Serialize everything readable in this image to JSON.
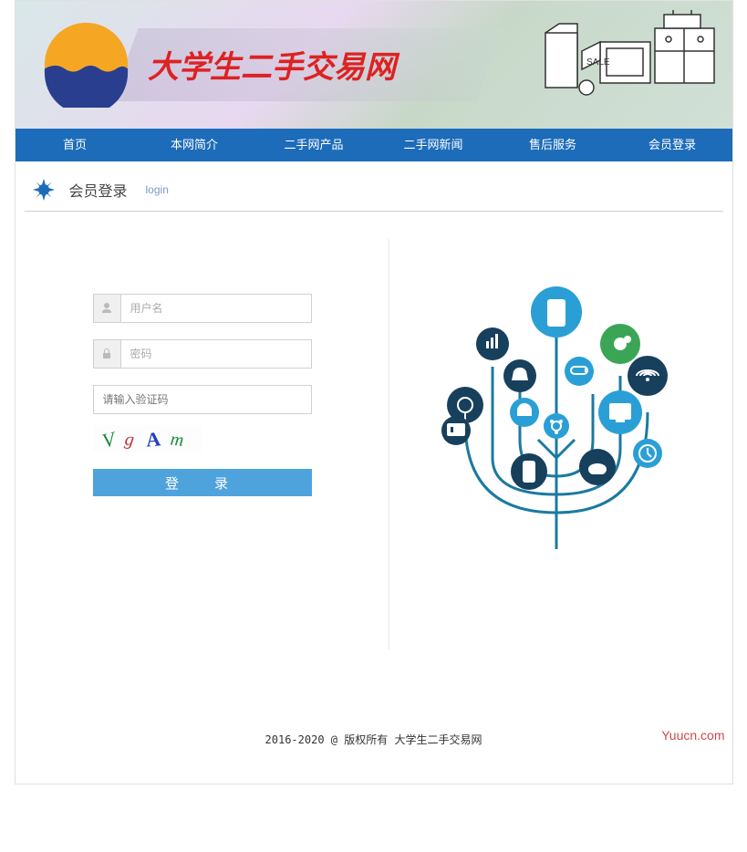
{
  "site": {
    "title": "大学生二手交易网"
  },
  "nav": {
    "items": [
      {
        "label": "首页"
      },
      {
        "label": "本网简介"
      },
      {
        "label": "二手网产品"
      },
      {
        "label": "二手网新闻"
      },
      {
        "label": "售后服务"
      },
      {
        "label": "会员登录"
      }
    ]
  },
  "section": {
    "title": "会员登录",
    "sub": "login"
  },
  "login": {
    "username_placeholder": "用户名",
    "password_placeholder": "密码",
    "captcha_placeholder": "请输入验证码",
    "captcha_text": "VgAm",
    "button_label": "登　录"
  },
  "banner_right": {
    "sale_label": "SALE"
  },
  "footer": {
    "copyright": "2016-2020 @ 版权所有 大学生二手交易网"
  },
  "watermark": {
    "text": "Yuucn.com"
  }
}
